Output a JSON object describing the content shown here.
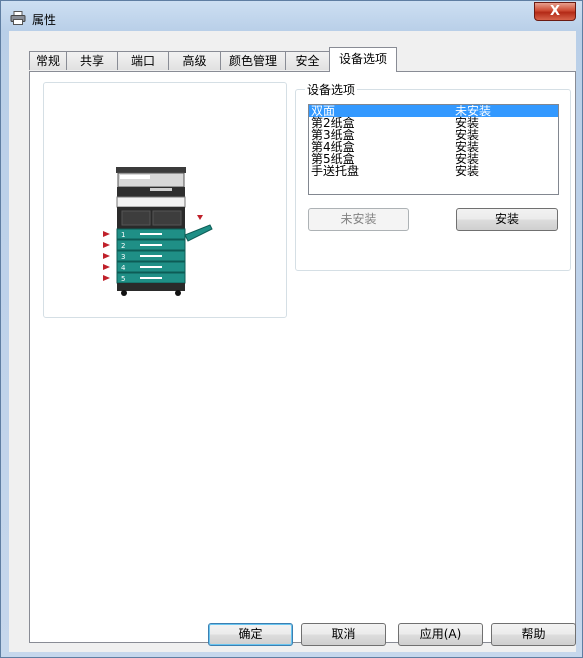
{
  "window": {
    "title": "属性",
    "close_label": "X"
  },
  "tabs": [
    "常规",
    "共享",
    "端口",
    "高级",
    "颜色管理",
    "安全",
    "设备选项"
  ],
  "active_tab": "设备选项",
  "options_group": {
    "title": "设备选项",
    "items": [
      {
        "name": "双面",
        "status": "未安装",
        "selected": true
      },
      {
        "name": "第2纸盒",
        "status": "安装"
      },
      {
        "name": "第3纸盒",
        "status": "安装"
      },
      {
        "name": "第4纸盒",
        "status": "安装"
      },
      {
        "name": "第5纸盒",
        "status": "安装"
      },
      {
        "name": "手送托盘",
        "status": "安装"
      }
    ],
    "not_installed_button": "未安装",
    "install_button": "安装"
  },
  "printer_tray_numbers": [
    "1",
    "2",
    "3",
    "4",
    "5"
  ],
  "footer": {
    "ok": "确定",
    "cancel": "取消",
    "apply": "应用(A)",
    "help": "帮助"
  },
  "colors": {
    "accent_selection": "#3399ff",
    "tray_teal": "#1f8f86",
    "arrow_red": "#c0202a"
  }
}
